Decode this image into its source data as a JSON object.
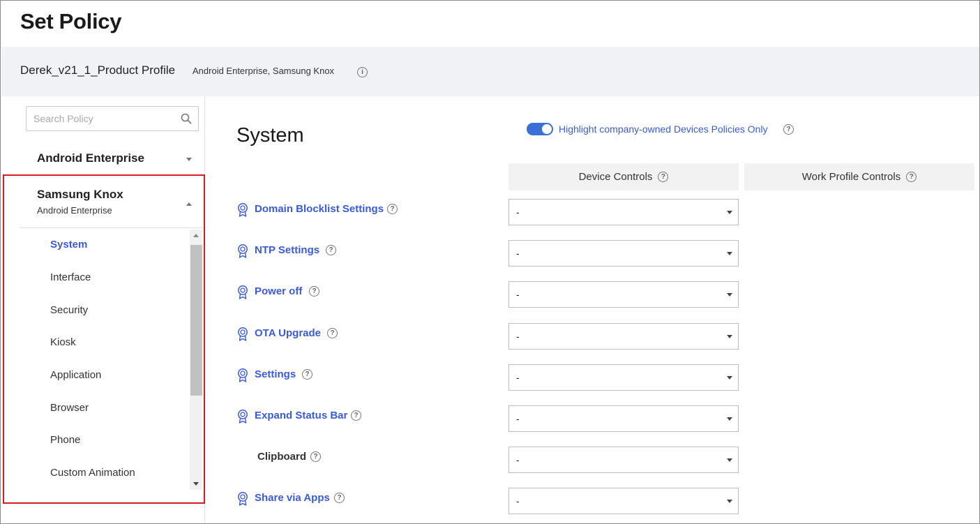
{
  "header": {
    "title": "Set Policy"
  },
  "profile": {
    "name": "Derek_v21_1_Product Profile",
    "platforms": "Android Enterprise, Samsung Knox",
    "info_glyph": "i"
  },
  "sidebar": {
    "search_placeholder": "Search Policy",
    "groups": [
      {
        "label": "Android Enterprise",
        "expanded": false
      },
      {
        "label": "Samsung Knox",
        "sublabel": "Android Enterprise",
        "expanded": true
      }
    ],
    "items": [
      {
        "label": "System",
        "active": true
      },
      {
        "label": "Interface"
      },
      {
        "label": "Security"
      },
      {
        "label": "Kiosk"
      },
      {
        "label": "Application"
      },
      {
        "label": "Browser"
      },
      {
        "label": "Phone"
      },
      {
        "label": "Custom Animation"
      }
    ],
    "highlight_color": "#d51c24"
  },
  "main": {
    "title": "System",
    "toggle": {
      "label": "Highlight company-owned Devices Policies Only",
      "on": true
    },
    "columns": {
      "device": "Device Controls",
      "work": "Work Profile Controls"
    },
    "help_glyph": "?",
    "policies": [
      {
        "label": "Domain Blocklist Settings",
        "value": "-",
        "badge": true
      },
      {
        "label": "NTP Settings",
        "value": "-",
        "badge": true
      },
      {
        "label": "Power off",
        "value": "-",
        "badge": true
      },
      {
        "label": "OTA Upgrade",
        "value": "-",
        "badge": true
      },
      {
        "label": "Settings",
        "value": "-",
        "badge": true
      },
      {
        "label": "Expand Status Bar",
        "value": "-",
        "badge": true
      },
      {
        "label": "Clipboard",
        "value": "-",
        "badge": false
      },
      {
        "label": "Share via Apps",
        "value": "-",
        "badge": true
      }
    ]
  },
  "colors": {
    "accent": "#3a5bd9",
    "toggle": "#3a6fd8",
    "bar_bg": "#f0f2f5"
  }
}
